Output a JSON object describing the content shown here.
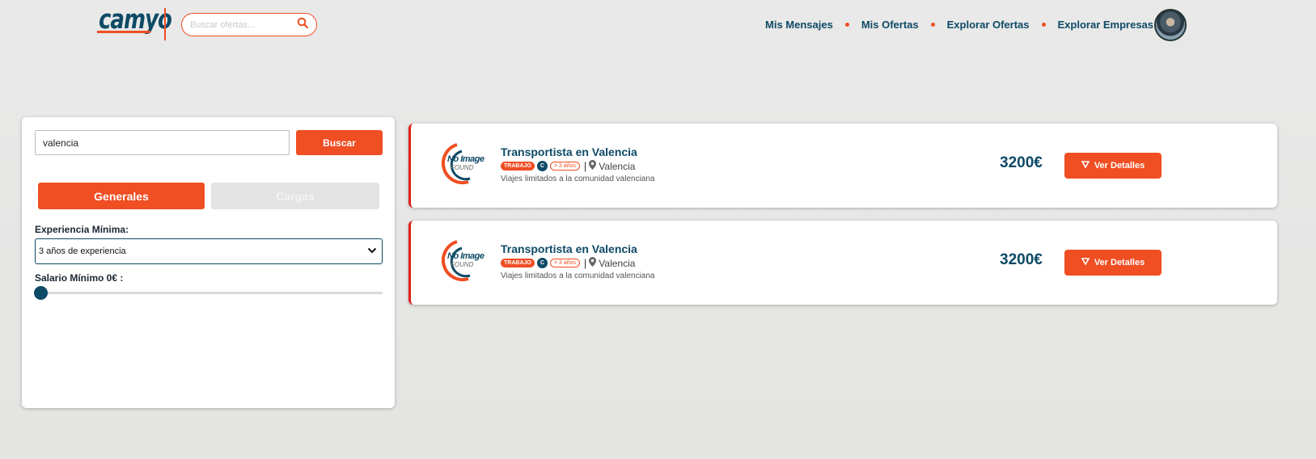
{
  "header": {
    "logo_text": "camyo",
    "search": {
      "placeholder": "Buscar ofertas...",
      "icon": "search-icon"
    },
    "nav": [
      {
        "label": "Mis Mensajes"
      },
      {
        "label": "Mis Ofertas"
      },
      {
        "label": "Explorar Ofertas"
      },
      {
        "label": "Explorar Empresas"
      }
    ],
    "avatar": "user-avatar"
  },
  "filters": {
    "query_value": "valencia",
    "search_button": "Buscar",
    "tabs": [
      {
        "label": "Generales",
        "active": true
      },
      {
        "label": "Cargas",
        "active": false
      }
    ],
    "experience_label": "Experiencia Mínima:",
    "experience_value": "3 años de experiencia",
    "salary_label": "Salario Mínimo 0€ :",
    "salary_value": 0
  },
  "offers": [
    {
      "image_text_1": "No Image",
      "image_text_2": "FOUND",
      "title": "Transportista en Valencia",
      "tag_type": "TRABAJO",
      "tag_license": "C",
      "tag_experience": "> 3 años",
      "location": "Valencia",
      "description": "Viajes limitados a la comunidad valenciana",
      "price": "3200€",
      "details_button": "Ver Detalles"
    },
    {
      "image_text_1": "No Image",
      "image_text_2": "FOUND",
      "title": "Transportista en Valencia",
      "tag_type": "TRABAJO",
      "tag_license": "C",
      "tag_experience": "> 3 años",
      "location": "Valencia",
      "description": "Viajes limitados a la comunidad valenciana",
      "price": "3200€",
      "details_button": "Ver Detalles"
    }
  ],
  "colors": {
    "accent": "#f04e23",
    "primary": "#0d4a66",
    "card_border": "#e0201b"
  }
}
